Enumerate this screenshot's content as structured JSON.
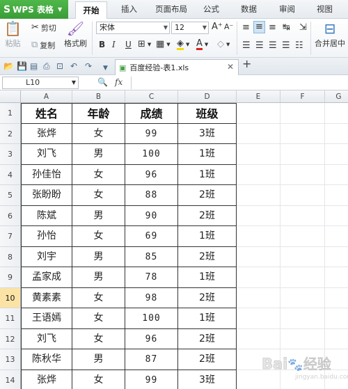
{
  "app": {
    "name": "WPS 表格",
    "logo": "S"
  },
  "tabs": [
    "开始",
    "插入",
    "页面布局",
    "公式",
    "数据",
    "审阅",
    "视图"
  ],
  "active_tab": "开始",
  "ribbon": {
    "paste": "粘贴",
    "cut": "剪切",
    "copy": "复制",
    "format_painter": "格式刷",
    "font_name": "宋体",
    "font_size": "12",
    "bold": "B",
    "italic": "I",
    "underline": "U",
    "merge_center": "合并居中",
    "font_color": "#d9241b",
    "highlight_color": "#f5d800"
  },
  "document_tab": {
    "name": "百度经验-表1.xls"
  },
  "formula_bar": {
    "cell_ref": "L10",
    "fx": "fx",
    "value": ""
  },
  "columns": [
    "A",
    "B",
    "C",
    "D",
    "E",
    "F",
    "G"
  ],
  "selected_row": 10,
  "table": {
    "headers": [
      "姓名",
      "年龄",
      "成绩",
      "班级"
    ],
    "rows": [
      [
        "张烨",
        "女",
        "99",
        "3班"
      ],
      [
        "刘飞",
        "男",
        "100",
        "1班"
      ],
      [
        "孙佳怡",
        "女",
        "96",
        "1班"
      ],
      [
        "张盼盼",
        "女",
        "88",
        "2班"
      ],
      [
        "陈斌",
        "男",
        "90",
        "2班"
      ],
      [
        "孙怡",
        "女",
        "69",
        "1班"
      ],
      [
        "刘宇",
        "男",
        "85",
        "2班"
      ],
      [
        "孟家成",
        "男",
        "78",
        "1班"
      ],
      [
        "黄素素",
        "女",
        "98",
        "2班"
      ],
      [
        "王语嫣",
        "女",
        "100",
        "1班"
      ],
      [
        "刘飞",
        "女",
        "96",
        "2班"
      ],
      [
        "陈秋华",
        "男",
        "87",
        "2班"
      ],
      [
        "张烨",
        "女",
        "99",
        "3班"
      ]
    ]
  },
  "row_numbers": [
    "1",
    "2",
    "3",
    "4",
    "5",
    "6",
    "7",
    "8",
    "9",
    "10",
    "11",
    "12",
    "13",
    "14"
  ],
  "watermark": {
    "text1": "Bai",
    "text2": "经验",
    "url": "jingyan.baidu.com"
  }
}
